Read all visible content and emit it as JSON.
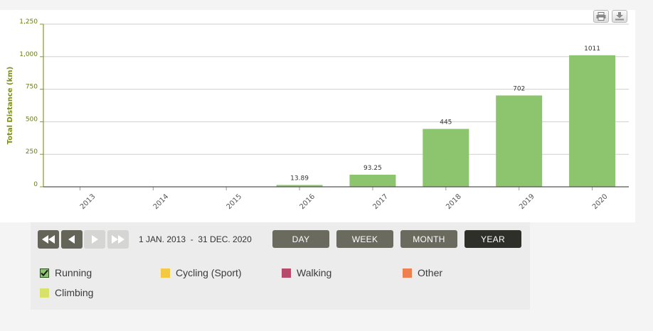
{
  "chart_data": {
    "type": "bar",
    "categories": [
      "2013",
      "2014",
      "2015",
      "2016",
      "2017",
      "2018",
      "2019",
      "2020"
    ],
    "values": [
      0,
      0,
      0,
      13.89,
      93.25,
      445,
      702,
      1011
    ],
    "data_labels": [
      "",
      "",
      "",
      "13.89",
      "93.25",
      "445",
      "702",
      "1011"
    ],
    "ylabel": "Total Distance (km)",
    "ylim": [
      0,
      1250
    ],
    "yticks": [
      0,
      250,
      500,
      750,
      1000,
      1250
    ],
    "ytick_labels": [
      "0",
      "250",
      "500",
      "750",
      "1,000",
      "1,250"
    ],
    "grid": true,
    "bar_color": "#8dc56f",
    "axis_color": "#8a9a1c"
  },
  "toolbar": {
    "print_icon": "print-icon",
    "download_icon": "download-icon"
  },
  "controls": {
    "date_range": "1 JAN. 2013  -  31 DEC. 2020",
    "periods": [
      {
        "label": "DAY",
        "selected": false
      },
      {
        "label": "WEEK",
        "selected": false
      },
      {
        "label": "MONTH",
        "selected": false
      },
      {
        "label": "YEAR",
        "selected": true
      }
    ],
    "nav": {
      "first_icon": "double-chevron-left-icon",
      "prev_icon": "triangle-left-icon",
      "next_icon": "triangle-right-icon",
      "last_icon": "double-chevron-right-icon"
    }
  },
  "legend": [
    {
      "label": "Running",
      "color": "#8dc56f",
      "checked": true
    },
    {
      "label": "Cycling (Sport)",
      "color": "#f5c842",
      "checked": false
    },
    {
      "label": "Walking",
      "color": "#b74a6a",
      "checked": false
    },
    {
      "label": "Other",
      "color": "#ee7f50",
      "checked": false
    },
    {
      "label": "Climbing",
      "color": "#d8e26a",
      "checked": false
    }
  ]
}
